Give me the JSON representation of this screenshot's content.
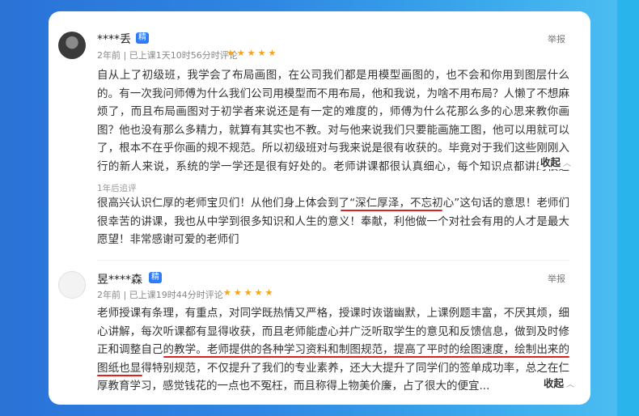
{
  "reviews": [
    {
      "username": "****丢",
      "badge": "精",
      "meta": "2年前 | 已上课1天10时56分时评论",
      "rating_stars": 5,
      "stars_text": "★★★★★",
      "report_label": "举报",
      "content": "自从上了初级班，我学会了布局画图，在公司我们都是用模型画图的，也不会和你用到图层什么的。有一次我问师傅为什么我们公司用模型而不用布局，他和我说，为啥不用布局？人懒了不想麻烦了，而且布局画图对于初学者来说还是有一定的难度的，师傅为什么花那么多的心思来教你画图？他也没有那么多精力，就算有其实也不教。对与他来说我们只要能画施工图，他可以用就可以了，根本不在乎你画的规不规范。所以初级班对与我来说是很有收获的。毕竟对于我们这些刚刚入行的新人来说，系统的学一学还是很有好处的。老师讲课都很认真细心，每个知识点都讲的很透彻，谢谢老师的辛苦付",
      "collapse_label": "收起",
      "followup_tag": "1年后追评",
      "followup": "很高兴认识仁厚的老师宝贝们！从他们身上体会到了“深仁厚泽，不忘初心”这句话的意思！老师们很幸苦的讲课，我也从中学到很多知识和人生的意义！奉献，利他做一个对社会有用的人才是最大愿望！非常感谢可爱的老师们"
    },
    {
      "username": "昱****森",
      "badge": "精",
      "meta": "2年前 | 已上课19时44分时评论",
      "rating_stars": 5,
      "stars_text": "★★★★★",
      "report_label": "举报",
      "content": "老师授课有条理，有重点，对同学既热情又严格，授课时诙谐幽默，上课例题丰富，不厌其烦，细心讲解，每次听课都有显得收获，而且老师能虚心并广泛听取学生的意见和反馈信息，做到及时修正和调整自己的教学。老师提供的各种学习资料和制图规范，提高了平时的绘图速度，绘制出来的图纸也显得特别规范，不仅提升了我们的专业素养，还大大提升了同学们的签单成功率，总之在仁厚教育学习，感觉钱花的一点也不冤枉，而且称得上物美价廉，占了很大的便宜...",
      "collapse_label": "收起"
    }
  ],
  "colors": {
    "accent": "#2f7cf6",
    "star": "#f7a21b",
    "highlight": "#e02020"
  },
  "icons": {
    "collapse": "chevron-up-icon",
    "rating": "star-icon"
  }
}
